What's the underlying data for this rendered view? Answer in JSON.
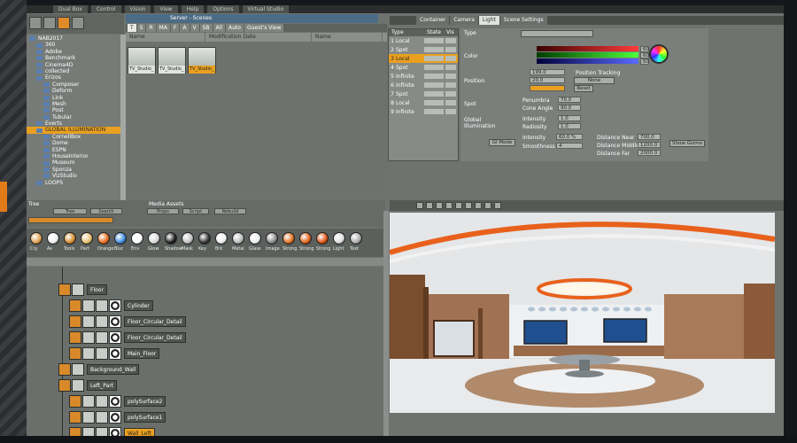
{
  "menu": [
    "Dual Box",
    "Control",
    "Vision",
    "View",
    "Help",
    "Options",
    "Virtual Studio"
  ],
  "server": {
    "title": "Server - Scenes",
    "tree": [
      {
        "label": "NAB2017",
        "depth": 0
      },
      {
        "label": "360",
        "depth": 1
      },
      {
        "label": "Adobe",
        "depth": 1
      },
      {
        "label": "Benchmark",
        "depth": 1
      },
      {
        "label": "Cinema4D",
        "depth": 1
      },
      {
        "label": "collected",
        "depth": 1
      },
      {
        "label": "Erizos",
        "depth": 1
      },
      {
        "label": "Composer",
        "depth": 2
      },
      {
        "label": "Deform",
        "depth": 2
      },
      {
        "label": "Link",
        "depth": 2
      },
      {
        "label": "Mesh",
        "depth": 2
      },
      {
        "label": "Post",
        "depth": 2
      },
      {
        "label": "Tubular",
        "depth": 2
      },
      {
        "label": "Everts",
        "depth": 1
      },
      {
        "label": "GLOBAL ILLUMINATION",
        "depth": 1,
        "selected": true
      },
      {
        "label": "CornellBox",
        "depth": 2
      },
      {
        "label": "Dome",
        "depth": 2
      },
      {
        "label": "ESPN",
        "depth": 2
      },
      {
        "label": "HouseInterior",
        "depth": 2
      },
      {
        "label": "Museum",
        "depth": 2
      },
      {
        "label": "Sponza",
        "depth": 2
      },
      {
        "label": "VizStudio",
        "depth": 2
      },
      {
        "label": "LOOPS",
        "depth": 1
      }
    ],
    "scene_tabs": [
      "T",
      "S",
      "R",
      "MA",
      "F",
      "A",
      "V",
      "SB",
      "All",
      "Auto",
      "Guest's View"
    ],
    "scene_columns": [
      "Name",
      "Modification Date",
      "Name"
    ],
    "thumbnails": [
      {
        "label": "TV_Studio_",
        "selected": false
      },
      {
        "label": "TV_Studio_",
        "selected": false
      },
      {
        "label": "TV_Studio_",
        "selected": true
      }
    ]
  },
  "editor": {
    "tabs": [
      "Container",
      "Camera",
      "Light",
      "Scene Settings"
    ],
    "active_tab": "Light",
    "light_columns": [
      "Type",
      "State",
      "Vis"
    ],
    "lights": [
      {
        "num": "1",
        "type": "Local"
      },
      {
        "num": "2",
        "type": "Spot"
      },
      {
        "num": "3",
        "type": "Local",
        "selected": true
      },
      {
        "num": "4",
        "type": "Spot"
      },
      {
        "num": "5",
        "type": "Infinite"
      },
      {
        "num": "6",
        "type": "Infinite"
      },
      {
        "num": "7",
        "type": "Spot"
      },
      {
        "num": "8",
        "type": "Local"
      },
      {
        "num": "9",
        "type": "Infinite"
      }
    ],
    "labels": {
      "type": "Type",
      "color": "Color",
      "position": "Position",
      "spot": "Spot",
      "global_illumination": "Global Illumination",
      "position_tracking": "Position Tracking",
      "penumbra": "Penumbra",
      "cone_angle": "Cone Angle",
      "intensity": "Intensity",
      "radiosity": "Radiosity",
      "intensity2": "Intensity",
      "smoothness": "Smoothness",
      "distance_near": "Distance Near",
      "distance_middle": "Distance Middle",
      "distance_far": "Distance Far",
      "none": "None",
      "reset": "Reset",
      "gi_button": "GI Mode",
      "show_gizmo": "Show Gizmo"
    },
    "values": {
      "color_r": "60",
      "color_g": "60",
      "color_b": "60",
      "pos_x": "199.0",
      "pos_y": "20.0",
      "pos_z": "",
      "penumbra": "70.0",
      "cone_angle": "90.0",
      "intensity": "1.0",
      "radiosity": "1.0",
      "gi_intensity": "60.0 %",
      "smoothness": "4",
      "distance_near": "700.0",
      "distance_middle": "1200.0",
      "distance_far": "2000.0"
    }
  },
  "tree_panel": {
    "label": "Tree",
    "media_assets": "Media Assets",
    "buttons": [
      "Tree",
      "Search",
      "Props",
      "Script",
      "Rebuild"
    ],
    "shaders": [
      "Cry",
      "Av",
      "Tools",
      "Part",
      "Orange",
      "Blur",
      "Env",
      "Glow",
      "Shadow",
      "Mask",
      "Key",
      "Brk",
      "Metal",
      "Glass",
      "Image",
      "Strong",
      "Strong",
      "Strong",
      "Light",
      "Text"
    ],
    "nodes": [
      {
        "label": "Floor",
        "depth": 0
      },
      {
        "label": "Cylinder",
        "depth": 1
      },
      {
        "label": "Floor_Circular_Detail",
        "depth": 1
      },
      {
        "label": "Floor_Circular_Detail",
        "depth": 1
      },
      {
        "label": "Main_Floor",
        "depth": 1
      },
      {
        "label": "Background_Wall",
        "depth": 0
      },
      {
        "label": "Left_Part",
        "depth": 0
      },
      {
        "label": "polySurface2",
        "depth": 1
      },
      {
        "label": "polySurface1",
        "depth": 1
      },
      {
        "label": "Wall_Left",
        "depth": 1,
        "selected": true
      }
    ]
  },
  "colors": {
    "accent": "#e9a020",
    "panel": "#6f736f",
    "studio_orange": "#e8611c",
    "title_blue": "#4c6c86"
  }
}
